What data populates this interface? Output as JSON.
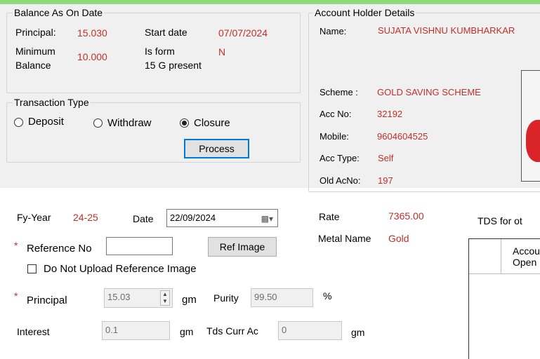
{
  "balance": {
    "title": "Balance As On Date",
    "principal_label": "Principal:",
    "principal_value": "15.030",
    "start_date_label": "Start date",
    "start_date_value": "07/07/2024",
    "min_balance_label_1": "Minimum",
    "min_balance_label_2": "Balance",
    "min_balance_value": "10.000",
    "is_form_label_1": "Is form",
    "is_form_label_2": "15 G present",
    "is_form_value": "N"
  },
  "transaction": {
    "title": "Transaction Type",
    "options": [
      "Deposit",
      "Withdraw",
      "Closure"
    ],
    "selected": "Closure",
    "process_label": "Process"
  },
  "holder": {
    "title": "Account Holder Details",
    "name_label": "Name:",
    "name_value": "SUJATA VISHNU KUMBHARKAR",
    "scheme_label": "Scheme :",
    "scheme_value": "GOLD SAVING SCHEME",
    "accno_label": "Acc No:",
    "accno_value": "32192",
    "mobile_label": "Mobile:",
    "mobile_value": "9604604525",
    "acctype_label": "Acc Type:",
    "acctype_value": "Self",
    "oldacno_label": "Old AcNo:",
    "oldacno_value": "197"
  },
  "form": {
    "fy_label": "Fy-Year",
    "fy_value": "24-25",
    "date_label": "Date",
    "date_value": "22/09/2024",
    "rate_label": "Rate",
    "rate_value": "7365.00",
    "metal_label": "Metal Name",
    "metal_value": "Gold",
    "tds_label": "TDS for ot",
    "ref_label": "Reference No",
    "ref_value": "",
    "ref_image_label": "Ref Image",
    "no_upload_label": "Do Not Upload Reference Image",
    "principal_label": "Principal",
    "principal_value": "15.03",
    "gm1": "gm",
    "purity_label": "Purity",
    "purity_value": "99.50",
    "percent": "%",
    "interest_label": "Interest",
    "interest_value": "0.1",
    "gm2": "gm",
    "tds_curr_label": "Tds Curr Ac",
    "tds_curr_value": "0",
    "gm3": "gm",
    "required_mark": "*"
  },
  "grid": {
    "header_line1": "Accou",
    "header_line2": "Open"
  },
  "colors": {
    "accent_strip": "#8fdd7a",
    "value_red": "#c0302a",
    "focus_blue": "#0078d7"
  }
}
